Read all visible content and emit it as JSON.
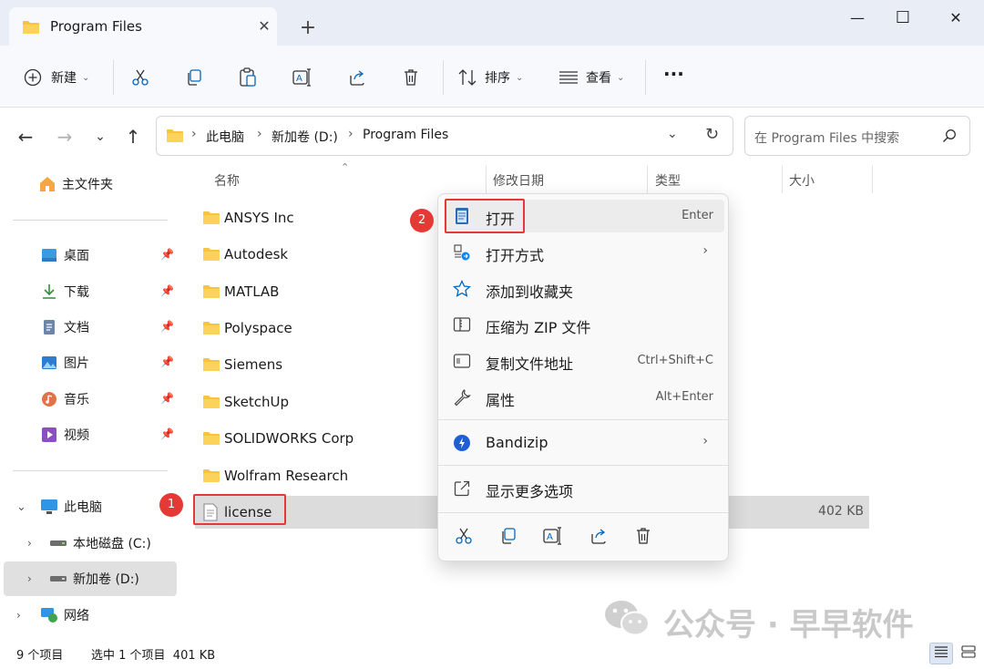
{
  "window": {
    "tab_title": "Program Files",
    "new_tab": "+",
    "close_tab": "✕",
    "minimize": "—",
    "maximize": "☐",
    "close": "✕"
  },
  "toolbar": {
    "new_label": "新建",
    "sort_label": "排序",
    "view_label": "查看",
    "more_label": "···"
  },
  "address": {
    "crumbs": [
      "此电脑",
      "新加卷 (D:)",
      "Program Files"
    ],
    "search_placeholder": "在 Program Files 中搜索"
  },
  "sidebar": {
    "home": "主文件夹",
    "pinned": [
      "桌面",
      "下载",
      "文档",
      "图片",
      "音乐",
      "视频"
    ],
    "this_pc": "此电脑",
    "drives": [
      "本地磁盘 (C:)",
      "新加卷 (D:)"
    ],
    "network": "网络"
  },
  "columns": {
    "name": "名称",
    "modified": "修改日期",
    "type": "类型",
    "size": "大小"
  },
  "files": [
    {
      "name": "ANSYS Inc"
    },
    {
      "name": "Autodesk"
    },
    {
      "name": "MATLAB"
    },
    {
      "name": "Polyspace"
    },
    {
      "name": "Siemens"
    },
    {
      "name": "SketchUp"
    },
    {
      "name": "SOLIDWORKS Corp"
    },
    {
      "name": "Wolfram Research"
    },
    {
      "name": "license",
      "size": "402 KB"
    }
  ],
  "menu": {
    "open": "打开",
    "open_shortcut": "Enter",
    "open_with": "打开方式",
    "add_fav": "添加到收藏夹",
    "zip": "压缩为 ZIP 文件",
    "copy_path": "复制文件地址",
    "copy_path_shortcut": "Ctrl+Shift+C",
    "properties": "属性",
    "properties_shortcut": "Alt+Enter",
    "bandizip": "Bandizip",
    "more_options": "显示更多选项"
  },
  "badges": {
    "one": "1",
    "two": "2"
  },
  "status": {
    "count": "9 个项目",
    "selected": "选中 1 个项目  401 KB"
  },
  "watermark": "公众号 · 早早软件",
  "colors": {
    "accent": "#0067c0",
    "folder": "#f8c43d",
    "highlight_red": "#e53935"
  }
}
